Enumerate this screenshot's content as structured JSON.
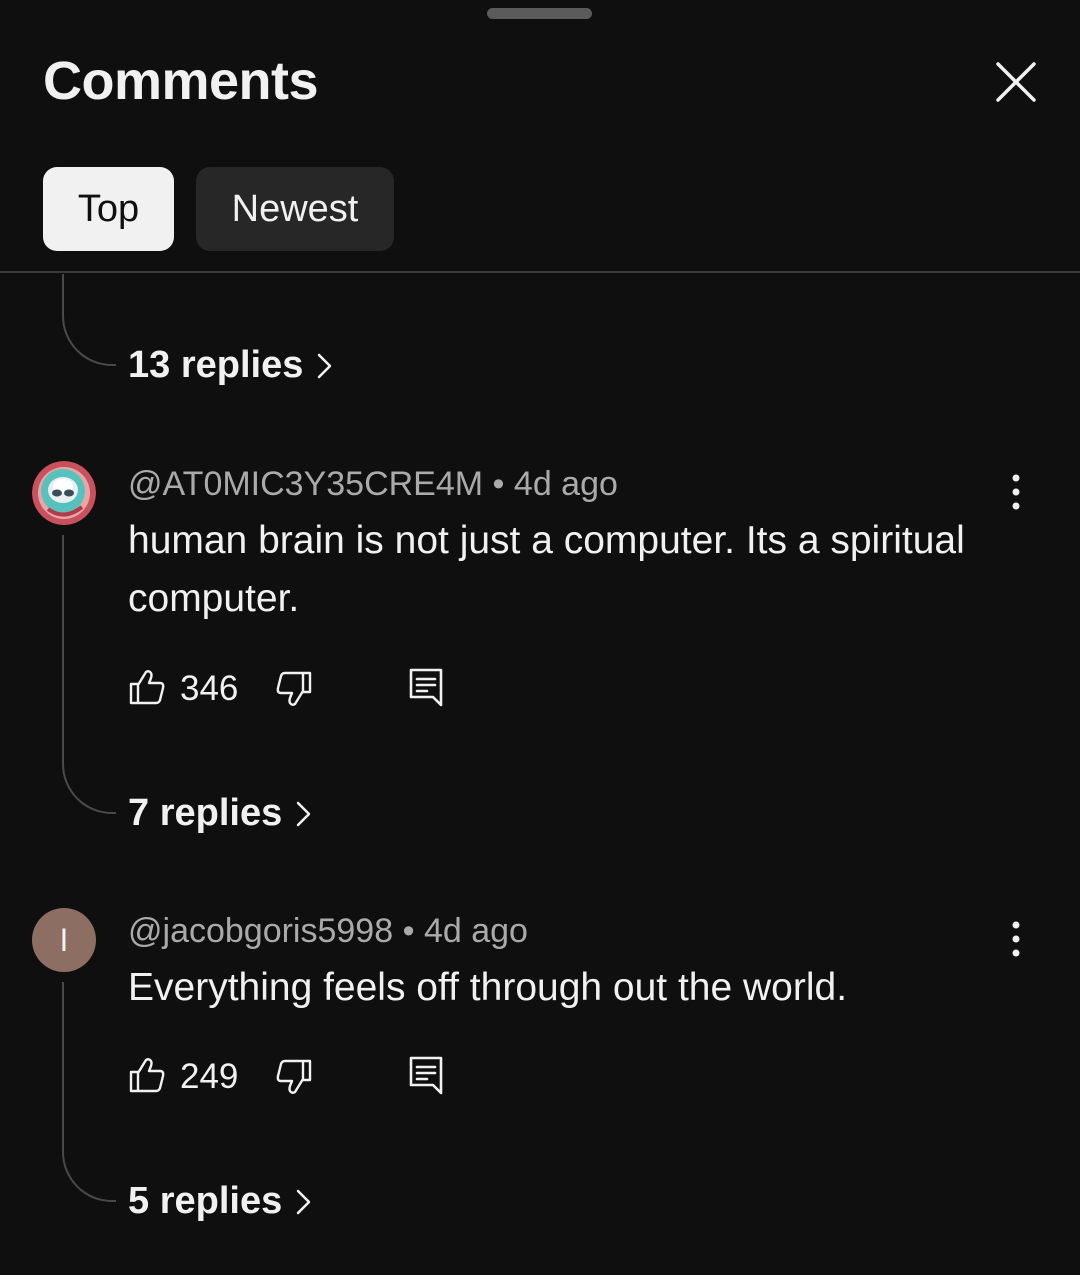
{
  "header": {
    "title": "Comments",
    "close_icon": "close-icon"
  },
  "sort_tabs": [
    {
      "label": "Top",
      "selected": true
    },
    {
      "label": "Newest",
      "selected": false
    }
  ],
  "previous_thread": {
    "replies_label": "13 replies"
  },
  "comments": [
    {
      "handle": "@AT0MIC3Y35CRE4M",
      "separator": "•",
      "time": "4d ago",
      "text": "human brain is not just a computer. Its a spiritual computer.",
      "likes": "346",
      "replies_label": "7 replies",
      "avatar_icon": "alien-avatar-icon"
    },
    {
      "handle": "@jacobgoris5998",
      "separator": "•",
      "time": "4d ago",
      "text": "Everything feels off through out the world.",
      "likes": "249",
      "replies_label": "5 replies",
      "avatar_letter": "I",
      "avatar_color": "#8d6e63"
    }
  ],
  "colors": {
    "background": "#0f0f0f",
    "text_primary": "#f1f1f1",
    "text_secondary": "#aaaaaa",
    "chip_selected": "#f1f1f1",
    "chip_unselected": "#272727"
  }
}
